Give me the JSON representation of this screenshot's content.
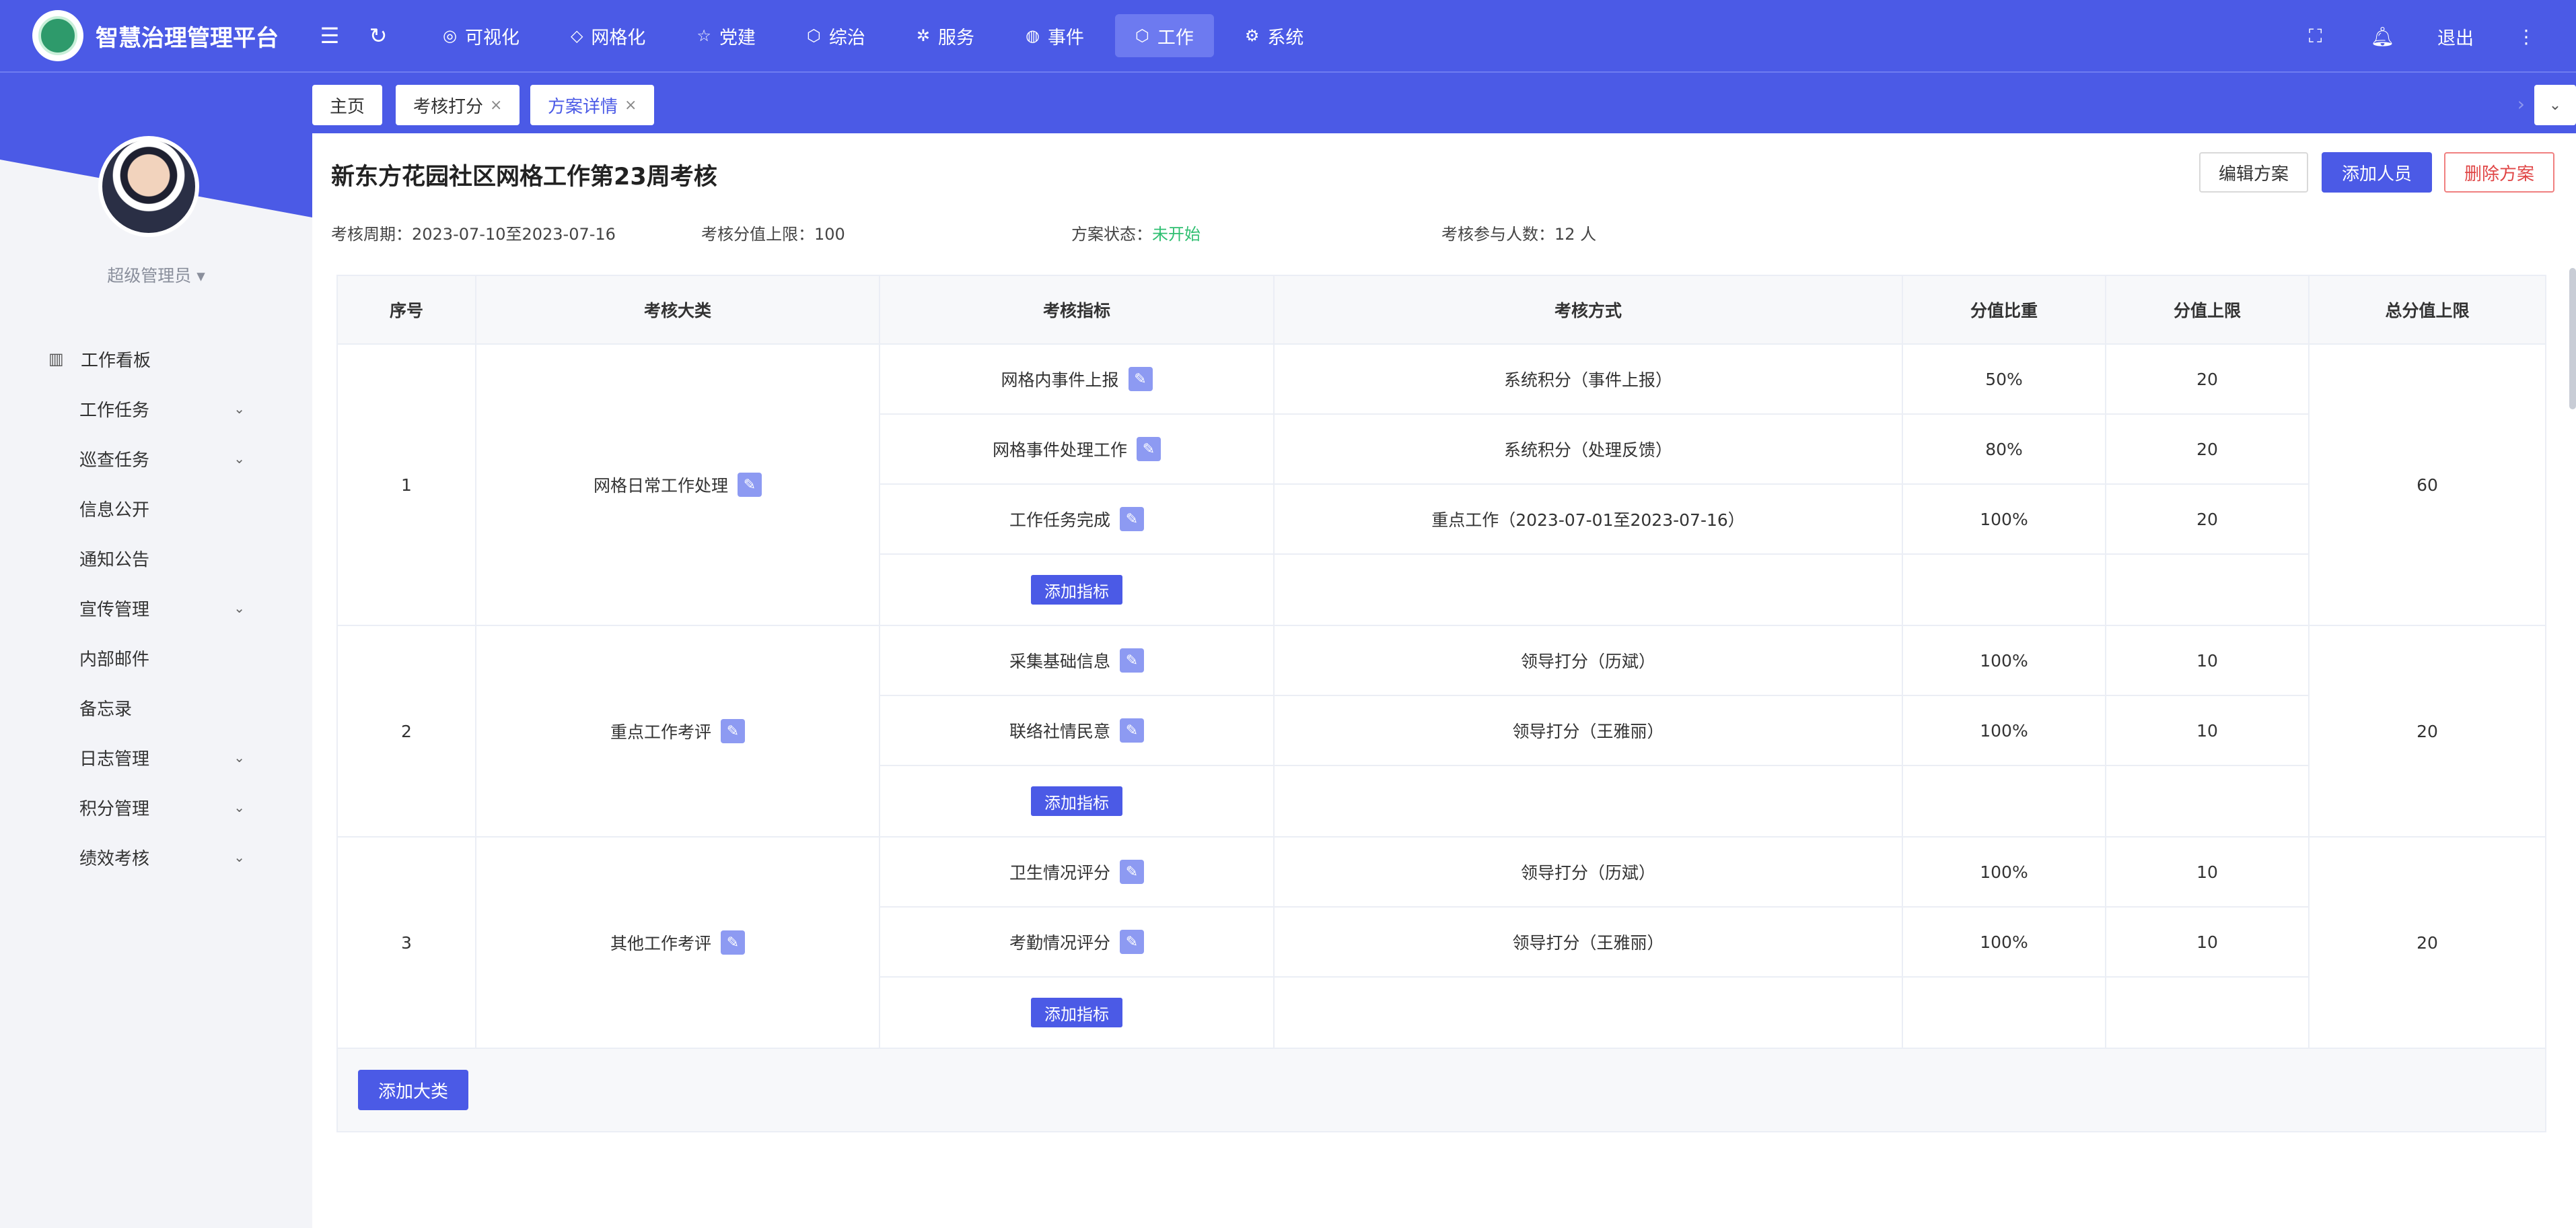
{
  "app": {
    "title": "智慧治理管理平台"
  },
  "topnav": {
    "items": [
      {
        "label": "可视化",
        "icon": "check-circle-icon",
        "glyph": "◎",
        "active": false
      },
      {
        "label": "网格化",
        "icon": "diamond-icon",
        "glyph": "◇",
        "active": false
      },
      {
        "label": "党建",
        "icon": "star-icon",
        "glyph": "☆",
        "active": false
      },
      {
        "label": "综治",
        "icon": "cube-icon",
        "glyph": "⬡",
        "active": false
      },
      {
        "label": "服务",
        "icon": "settings-icon",
        "glyph": "✲",
        "active": false
      },
      {
        "label": "事件",
        "icon": "location-pin-icon",
        "glyph": "◍",
        "active": false
      },
      {
        "label": "工作",
        "icon": "cube-icon",
        "glyph": "⬡",
        "active": true
      },
      {
        "label": "系统",
        "icon": "gear-icon",
        "glyph": "⚙",
        "active": false
      }
    ],
    "logout_label": "退出"
  },
  "sidebar": {
    "role": "超级管理员 ▾",
    "items": [
      {
        "label": "工作看板",
        "has_children": false
      },
      {
        "label": "工作任务",
        "has_children": true
      },
      {
        "label": "巡查任务",
        "has_children": true
      },
      {
        "label": "信息公开",
        "has_children": false
      },
      {
        "label": "通知公告",
        "has_children": false
      },
      {
        "label": "宣传管理",
        "has_children": true
      },
      {
        "label": "内部邮件",
        "has_children": false
      },
      {
        "label": "备忘录",
        "has_children": false
      },
      {
        "label": "日志管理",
        "has_children": true
      },
      {
        "label": "积分管理",
        "has_children": true
      },
      {
        "label": "绩效考核",
        "has_children": true
      }
    ]
  },
  "tags": [
    {
      "label": "主页",
      "closable": false,
      "active": false
    },
    {
      "label": "考核打分",
      "closable": true,
      "active": false
    },
    {
      "label": "方案详情",
      "closable": true,
      "active": true
    }
  ],
  "plan": {
    "title": "新东方花园社区网格工作第23周考核",
    "edit_label": "编辑方案",
    "add_person_label": "添加人员",
    "delete_label": "删除方案",
    "period_label": "考核周期：",
    "period_value": "2023-07-10至2023-07-16",
    "limit_label": "考核分值上限：",
    "limit_value": "100",
    "status_label": "方案状态：",
    "status_value": "未开始",
    "count_label": "考核参与人数：",
    "count_value": "12 人"
  },
  "table": {
    "headers": [
      "序号",
      "考核大类",
      "考核指标",
      "考核方式",
      "分值比重",
      "分值上限",
      "总分值上限"
    ],
    "add_indicator_label": "添加指标",
    "add_category_label": "添加大类",
    "groups": [
      {
        "seq": "1",
        "category": "网格日常工作处理",
        "total": "60",
        "rows": [
          {
            "indicator": "网格内事件上报",
            "method": "系统积分（事件上报）",
            "ratio": "50%",
            "limit": "20"
          },
          {
            "indicator": "网格事件处理工作",
            "method": "系统积分（处理反馈）",
            "ratio": "80%",
            "limit": "20"
          },
          {
            "indicator": "工作任务完成",
            "method": "重点工作（2023-07-01至2023-07-16）",
            "ratio": "100%",
            "limit": "20"
          }
        ]
      },
      {
        "seq": "2",
        "category": "重点工作考评",
        "total": "20",
        "rows": [
          {
            "indicator": "采集基础信息",
            "method": "领导打分（历斌）",
            "ratio": "100%",
            "limit": "10"
          },
          {
            "indicator": "联络社情民意",
            "method": "领导打分（王雅丽）",
            "ratio": "100%",
            "limit": "10"
          }
        ]
      },
      {
        "seq": "3",
        "category": "其他工作考评",
        "total": "20",
        "rows": [
          {
            "indicator": "卫生情况评分",
            "method": "领导打分（历斌）",
            "ratio": "100%",
            "limit": "10"
          },
          {
            "indicator": "考勤情况评分",
            "method": "领导打分（王雅丽）",
            "ratio": "100%",
            "limit": "10"
          }
        ]
      }
    ]
  },
  "colors": {
    "primary": "#4b5ae6",
    "status_green": "#2fbf71",
    "danger": "#e04646"
  }
}
